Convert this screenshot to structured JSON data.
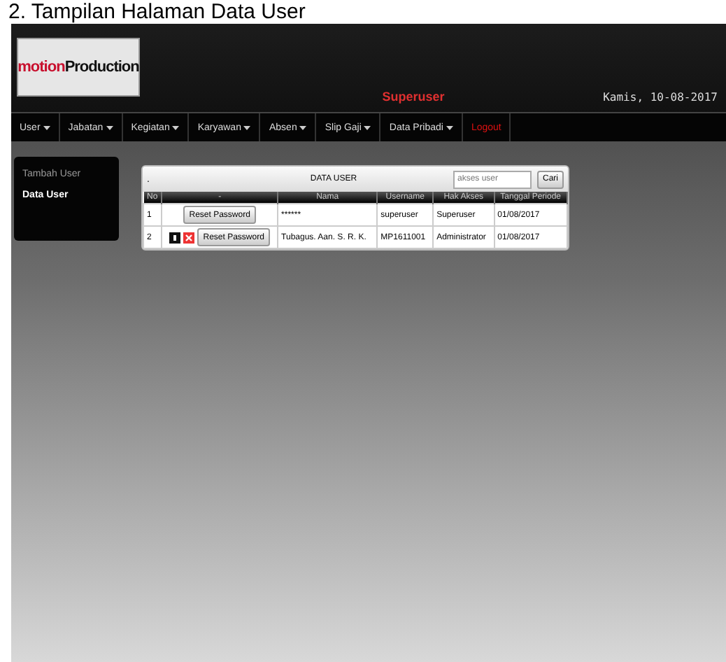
{
  "caption": "2. Tampilan Halaman Data User",
  "logo": [
    "motion",
    "Production"
  ],
  "user": "Superuser",
  "date": "Kamis, 10-08-2017",
  "menu": [
    {
      "label": "User",
      "dropdown": true,
      "kind": "normal"
    },
    {
      "label": "Jabatan",
      "dropdown": true,
      "kind": "normal"
    },
    {
      "label": "Kegiatan",
      "dropdown": true,
      "kind": "normal"
    },
    {
      "label": "Karyawan",
      "dropdown": true,
      "kind": "normal"
    },
    {
      "label": "Absen",
      "dropdown": true,
      "kind": "normal"
    },
    {
      "label": "Slip Gaji",
      "dropdown": true,
      "kind": "normal"
    },
    {
      "label": "Data Pribadi",
      "dropdown": true,
      "kind": "normal"
    },
    {
      "label": "Logout",
      "dropdown": false,
      "kind": "logout"
    }
  ],
  "sidebar": {
    "items": [
      {
        "label": "Tambah User",
        "selected": false
      },
      {
        "label": "Data User",
        "selected": true
      }
    ]
  },
  "panel": {
    "corner": ".",
    "title": "DATA USER",
    "search": {
      "placeholder": "akses user"
    },
    "button": "Cari"
  },
  "table": {
    "columns": [
      "No",
      "-",
      "Nama",
      "Username",
      "Hak Akses",
      "Tanggal Periode"
    ],
    "rows": [
      {
        "no": "1",
        "edit": false,
        "delete": false,
        "action": "Reset Password",
        "nama": "******",
        "username": "superuser",
        "hak": "Superuser",
        "tanggal": "01/08/2017"
      },
      {
        "no": "2",
        "edit": true,
        "delete": true,
        "action": "Reset Password",
        "nama": "Tubagus. Aan. S. R. K.",
        "username": "MP1611001",
        "hak": "Administrator",
        "tanggal": "01/08/2017"
      }
    ]
  }
}
